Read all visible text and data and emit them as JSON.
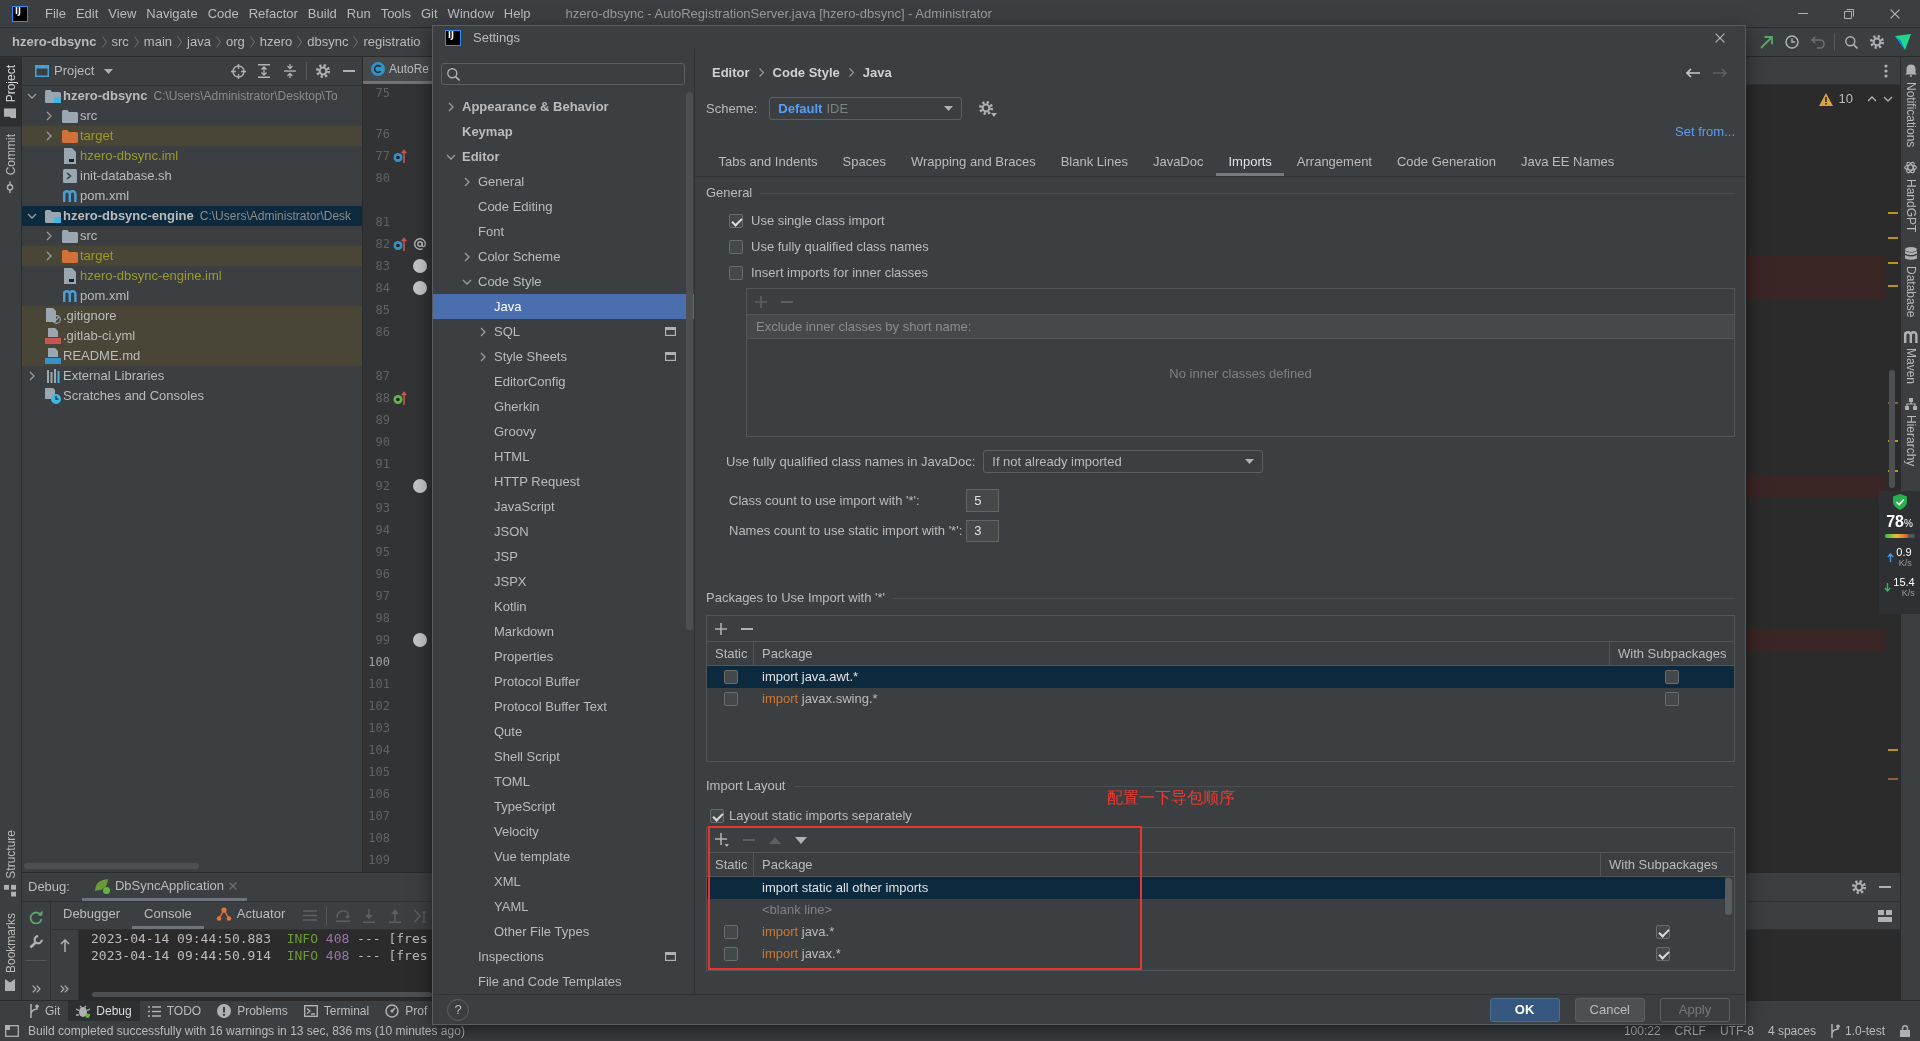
{
  "window": {
    "logo": "IJ",
    "title": "hzero-dbsync - AutoRegistrationServer.java [hzero-dbsync] - Administrator"
  },
  "menu": [
    "File",
    "Edit",
    "View",
    "Navigate",
    "Code",
    "Refactor",
    "Build",
    "Run",
    "Tools",
    "Git",
    "Window",
    "Help"
  ],
  "breadcrumbs": [
    "hzero-dbsync",
    "src",
    "main",
    "java",
    "org",
    "hzero",
    "dbsync",
    "registratio"
  ],
  "left_strip_top": [
    {
      "label": "Project",
      "kind": "project",
      "selected": true
    },
    {
      "label": "Commit",
      "kind": "commit",
      "selected": false
    }
  ],
  "left_strip_bottom": [
    {
      "label": "Structure",
      "kind": "structure"
    },
    {
      "label": "Bookmarks",
      "kind": "bookmarks"
    }
  ],
  "project": {
    "title": "Project",
    "tree": [
      {
        "name": "hzero-dbsync",
        "kind": "module",
        "path": "C:\\Users\\Administrator\\Desktop\\To",
        "expanded": true,
        "selected": false,
        "shaded": false,
        "ignored": false,
        "children": [
          {
            "name": "src",
            "kind": "folder",
            "expanded": false,
            "selected": false,
            "shaded": false,
            "ignored": false
          },
          {
            "name": "target",
            "kind": "excluded",
            "expanded": false,
            "selected": false,
            "shaded": true,
            "ignored": true
          },
          {
            "name": "hzero-dbsync.iml",
            "kind": "iml",
            "selected": false,
            "shaded": false,
            "ignored": true
          },
          {
            "name": "init-database.sh",
            "kind": "shell",
            "selected": false,
            "shaded": false,
            "ignored": false
          },
          {
            "name": "pom.xml",
            "kind": "maven",
            "selected": false,
            "shaded": false,
            "ignored": false
          }
        ]
      },
      {
        "name": "hzero-dbsync-engine",
        "kind": "module",
        "path": "C:\\Users\\Administrator\\Desk",
        "expanded": true,
        "selected": true,
        "shaded": false,
        "ignored": false,
        "children": [
          {
            "name": "src",
            "kind": "folder",
            "expanded": false,
            "selected": false,
            "shaded": false,
            "ignored": false
          },
          {
            "name": "target",
            "kind": "excluded",
            "expanded": false,
            "selected": false,
            "shaded": true,
            "ignored": true
          },
          {
            "name": "hzero-dbsync-engine.iml",
            "kind": "iml",
            "selected": false,
            "shaded": false,
            "ignored": true
          },
          {
            "name": "pom.xml",
            "kind": "maven",
            "selected": false,
            "shaded": false,
            "ignored": false
          }
        ]
      },
      {
        "name": ".gitignore",
        "kind": "gitignore",
        "selected": false,
        "shaded": true,
        "ignored": false
      },
      {
        "name": ".gitlab-ci.yml",
        "kind": "yaml",
        "selected": false,
        "shaded": true,
        "ignored": false
      },
      {
        "name": "README.md",
        "kind": "markdown",
        "selected": false,
        "shaded": true,
        "ignored": false
      },
      {
        "name": "External Libraries",
        "kind": "libraries",
        "expanded": false,
        "selected": false,
        "shaded": false,
        "ignored": false
      },
      {
        "name": "Scratches and Consoles",
        "kind": "scratches",
        "selected": false,
        "shaded": false,
        "ignored": false
      }
    ]
  },
  "editor": {
    "tab": "AutoRe",
    "problems": "10",
    "lines": [
      {
        "kind": "line",
        "number": "75",
        "current": false
      },
      {
        "kind": "hint"
      },
      {
        "kind": "line",
        "number": "76",
        "current": false
      },
      {
        "kind": "line",
        "number": "77",
        "current": false,
        "marks": [
          {
            "kind": "overrides"
          }
        ]
      },
      {
        "kind": "line",
        "number": "80",
        "current": false
      },
      {
        "kind": "hint"
      },
      {
        "kind": "line",
        "number": "81",
        "current": false
      },
      {
        "kind": "line",
        "number": "82",
        "current": false,
        "marks": [
          {
            "kind": "overrides"
          },
          {
            "kind": "annotation"
          }
        ]
      },
      {
        "kind": "line",
        "number": "83",
        "current": false,
        "marks": [
          {
            "kind": "breakpoint"
          }
        ]
      },
      {
        "kind": "line",
        "number": "84",
        "current": false,
        "marks": [
          {
            "kind": "breakpoint"
          }
        ]
      },
      {
        "kind": "line",
        "number": "85",
        "current": false
      },
      {
        "kind": "line",
        "number": "86",
        "current": false
      },
      {
        "kind": "hint"
      },
      {
        "kind": "line",
        "number": "87",
        "current": false
      },
      {
        "kind": "line",
        "number": "88",
        "current": false,
        "marks": [
          {
            "kind": "implements"
          }
        ]
      },
      {
        "kind": "line",
        "number": "89",
        "current": false
      },
      {
        "kind": "line",
        "number": "90",
        "current": false
      },
      {
        "kind": "line",
        "number": "91",
        "current": false
      },
      {
        "kind": "line",
        "number": "92",
        "current": false,
        "marks": [
          {
            "kind": "breakpoint"
          }
        ]
      },
      {
        "kind": "line",
        "number": "93",
        "current": false
      },
      {
        "kind": "line",
        "number": "94",
        "current": false
      },
      {
        "kind": "line",
        "number": "95",
        "current": false
      },
      {
        "kind": "line",
        "number": "96",
        "current": false
      },
      {
        "kind": "line",
        "number": "97",
        "current": false
      },
      {
        "kind": "line",
        "number": "98",
        "current": false
      },
      {
        "kind": "line",
        "number": "99",
        "current": false,
        "marks": [
          {
            "kind": "breakpoint"
          }
        ]
      },
      {
        "kind": "line",
        "number": "100",
        "current": true
      },
      {
        "kind": "line",
        "number": "101",
        "current": false
      },
      {
        "kind": "line",
        "number": "102",
        "current": false
      },
      {
        "kind": "line",
        "number": "103",
        "current": false
      },
      {
        "kind": "line",
        "number": "104",
        "current": false
      },
      {
        "kind": "line",
        "number": "105",
        "current": false
      },
      {
        "kind": "line",
        "number": "106",
        "current": false
      },
      {
        "kind": "line",
        "number": "107",
        "current": false
      },
      {
        "kind": "line",
        "number": "108",
        "current": false
      },
      {
        "kind": "line",
        "number": "109",
        "current": false
      }
    ]
  },
  "debug": {
    "title": "Debug:",
    "session": "DbSyncApplication",
    "tabs": [
      {
        "label": "Debugger",
        "kind": "debugger",
        "selected": false
      },
      {
        "label": "Console",
        "kind": "console",
        "selected": true
      },
      {
        "label": "Actuator",
        "kind": "actuator",
        "selected": false
      }
    ],
    "console": [
      {
        "time": "2023-04-14 09:44:50.883",
        "severity": "INFO",
        "pid": "408",
        "separator": "---",
        "thread": "[fres"
      },
      {
        "time": "2023-04-14 09:44:50.914",
        "severity": "INFO",
        "pid": "408",
        "separator": "---",
        "thread": "[fres"
      }
    ]
  },
  "tool_windows": [
    {
      "label": "Git",
      "kind": "git",
      "selected": false
    },
    {
      "label": "Debug",
      "kind": "debug",
      "selected": true
    },
    {
      "label": "TODO",
      "kind": "todo",
      "selected": false
    },
    {
      "label": "Problems",
      "kind": "problems",
      "selected": false
    },
    {
      "label": "Terminal",
      "kind": "terminal",
      "selected": false
    },
    {
      "label": "Prof",
      "kind": "profiler",
      "selected": false
    }
  ],
  "status_bar": {
    "message": "Build completed successfully with 16 warnings in 13 sec, 836 ms (10 minutes ago)",
    "items": [
      "100:22",
      "CRLF",
      "UTF-8",
      "4 spaces"
    ],
    "branch": "1.0-test"
  },
  "right_strip": [
    {
      "label": "Notifications",
      "kind": "notifications"
    },
    {
      "label": "HandGPT",
      "kind": "gpt"
    },
    {
      "label": "Database",
      "kind": "database"
    },
    {
      "label": "Maven",
      "kind": "maven"
    },
    {
      "label": "Hierarchy",
      "kind": "hierarchy"
    }
  ],
  "monitor": {
    "value": "78",
    "unit": "%",
    "level": 0.78,
    "upload": {
      "value": "0.9",
      "unit": "K/s"
    },
    "download": {
      "value": "15.4",
      "unit": "K/s"
    }
  },
  "settings": {
    "logo": "IJ",
    "title": "Settings",
    "help": "?",
    "nav": [
      {
        "label": "Appearance & Behavior",
        "kind": "group",
        "expanded": false,
        "selected": false,
        "project_level": false
      },
      {
        "label": "Keymap",
        "kind": "page",
        "selected": false,
        "project_level": false
      },
      {
        "label": "Editor",
        "kind": "group",
        "expanded": true,
        "selected": false,
        "project_level": false,
        "children": [
          {
            "label": "General",
            "kind": "group",
            "expanded": false,
            "selected": false,
            "project_level": false
          },
          {
            "label": "Code Editing",
            "kind": "page",
            "selected": false,
            "project_level": false
          },
          {
            "label": "Font",
            "kind": "page",
            "selected": false,
            "project_level": false
          },
          {
            "label": "Color Scheme",
            "kind": "group",
            "expanded": false,
            "selected": false,
            "project_level": false
          },
          {
            "label": "Code Style",
            "kind": "group",
            "expanded": true,
            "selected": false,
            "project_level": false,
            "children": [
              {
                "label": "Java",
                "kind": "page",
                "selected": true,
                "project_level": false
              },
              {
                "label": "SQL",
                "kind": "group",
                "expanded": false,
                "selected": false,
                "project_level": true
              },
              {
                "label": "Style Sheets",
                "kind": "group",
                "expanded": false,
                "selected": false,
                "project_level": true
              },
              {
                "label": "EditorConfig",
                "kind": "page",
                "selected": false,
                "project_level": false
              },
              {
                "label": "Gherkin",
                "kind": "page",
                "selected": false,
                "project_level": false
              },
              {
                "label": "Groovy",
                "kind": "page",
                "selected": false,
                "project_level": false
              },
              {
                "label": "HTML",
                "kind": "page",
                "selected": false,
                "project_level": false
              },
              {
                "label": "HTTP Request",
                "kind": "page",
                "selected": false,
                "project_level": false
              },
              {
                "label": "JavaScript",
                "kind": "page",
                "selected": false,
                "project_level": false
              },
              {
                "label": "JSON",
                "kind": "page",
                "selected": false,
                "project_level": false
              },
              {
                "label": "JSP",
                "kind": "page",
                "selected": false,
                "project_level": false
              },
              {
                "label": "JSPX",
                "kind": "page",
                "selected": false,
                "project_level": false
              },
              {
                "label": "Kotlin",
                "kind": "page",
                "selected": false,
                "project_level": false
              },
              {
                "label": "Markdown",
                "kind": "page",
                "selected": false,
                "project_level": false
              },
              {
                "label": "Properties",
                "kind": "page",
                "selected": false,
                "project_level": false
              },
              {
                "label": "Protocol Buffer",
                "kind": "page",
                "selected": false,
                "project_level": false
              },
              {
                "label": "Protocol Buffer Text",
                "kind": "page",
                "selected": false,
                "project_level": false
              },
              {
                "label": "Qute",
                "kind": "page",
                "selected": false,
                "project_level": false
              },
              {
                "label": "Shell Script",
                "kind": "page",
                "selected": false,
                "project_level": false
              },
              {
                "label": "TOML",
                "kind": "page",
                "selected": false,
                "project_level": false
              },
              {
                "label": "TypeScript",
                "kind": "page",
                "selected": false,
                "project_level": false
              },
              {
                "label": "Velocity",
                "kind": "page",
                "selected": false,
                "project_level": false
              },
              {
                "label": "Vue template",
                "kind": "page",
                "selected": false,
                "project_level": false
              },
              {
                "label": "XML",
                "kind": "page",
                "selected": false,
                "project_level": false
              },
              {
                "label": "YAML",
                "kind": "page",
                "selected": false,
                "project_level": false
              },
              {
                "label": "Other File Types",
                "kind": "page",
                "selected": false,
                "project_level": false
              }
            ]
          },
          {
            "label": "Inspections",
            "kind": "page",
            "selected": false,
            "project_level": true
          },
          {
            "label": "File and Code Templates",
            "kind": "page",
            "selected": false,
            "project_level": false
          }
        ]
      }
    ],
    "breadcrumb": [
      "Editor",
      "Code Style",
      "Java"
    ],
    "scheme": {
      "label": "Scheme:",
      "name": "Default",
      "scope": "IDE"
    },
    "set_from": "Set from...",
    "tabs": [
      {
        "label": "Tabs and Indents",
        "selected": false
      },
      {
        "label": "Spaces",
        "selected": false
      },
      {
        "label": "Wrapping and Braces",
        "selected": false
      },
      {
        "label": "Blank Lines",
        "selected": false
      },
      {
        "label": "JavaDoc",
        "selected": false
      },
      {
        "label": "Imports",
        "selected": true
      },
      {
        "label": "Arrangement",
        "selected": false
      },
      {
        "label": "Code Generation",
        "selected": false
      },
      {
        "label": "Java EE Names",
        "selected": false
      }
    ],
    "general": {
      "title": "General",
      "options": [
        {
          "label": "Use single class import",
          "checked": true
        },
        {
          "label": "Use fully qualified class names",
          "checked": false
        },
        {
          "label": "Insert imports for inner classes",
          "checked": false
        }
      ],
      "inner_classes": {
        "toolbar": [
          {
            "kind": "add",
            "disabled": true
          },
          {
            "kind": "remove",
            "disabled": true
          }
        ],
        "column": "Exclude inner classes by short name:",
        "empty": "No inner classes defined"
      },
      "javadoc": {
        "label": "Use fully qualified class names in JavaDoc:",
        "value": "If not already imported"
      },
      "counts": [
        {
          "label": "Class count to use import with '*':",
          "value": "5"
        },
        {
          "label": "Names count to use static import with '*':",
          "value": "3"
        }
      ]
    },
    "packages": {
      "title": "Packages to Use Import with '*'",
      "toolbar": [
        {
          "kind": "add",
          "disabled": false
        },
        {
          "kind": "remove",
          "disabled": false
        }
      ],
      "columns": [
        "Static",
        "Package",
        "With Subpackages"
      ],
      "rows": [
        {
          "kind": "package",
          "static": false,
          "keyword": "import",
          "package": "java.awt.*",
          "subpackages": false,
          "selected": true
        },
        {
          "kind": "package",
          "static": false,
          "keyword": "import",
          "package": "javax.swing.*",
          "subpackages": false,
          "selected": false
        }
      ]
    },
    "layout": {
      "title": "Import Layout",
      "option": {
        "label": "Layout static imports separately",
        "checked": true
      },
      "toolbar": [
        {
          "kind": "add_menu",
          "disabled": false
        },
        {
          "kind": "remove",
          "disabled": true
        },
        {
          "kind": "up",
          "disabled": true
        },
        {
          "kind": "down",
          "disabled": false
        }
      ],
      "columns": [
        "Static",
        "Package",
        "With Subpackages"
      ],
      "rows": [
        {
          "kind": "all_other",
          "text": "import static all other imports",
          "selected": true
        },
        {
          "kind": "blank",
          "text": "<blank line>",
          "selected": false
        },
        {
          "kind": "package",
          "static": false,
          "keyword": "import",
          "package": "java.*",
          "subpackages": true,
          "selected": false
        },
        {
          "kind": "package",
          "static": false,
          "keyword": "import",
          "package": "javax.*",
          "subpackages": true,
          "selected": false
        }
      ]
    },
    "annotation": "配置一下导包顺序",
    "buttons": [
      {
        "label": "OK",
        "default": true,
        "disabled": false
      },
      {
        "label": "Cancel",
        "default": false,
        "disabled": false
      },
      {
        "label": "Apply",
        "default": false,
        "disabled": true
      }
    ]
  }
}
